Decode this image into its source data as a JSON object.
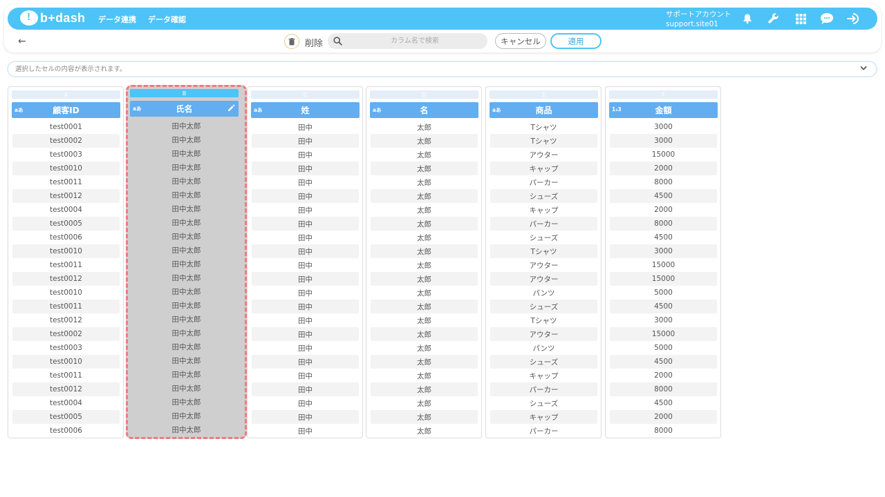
{
  "app": {
    "logo_text": "b+dash"
  },
  "nav": [
    "データ連携",
    "データ確認"
  ],
  "account": {
    "name": "サポートアカウント",
    "id": "support.site01"
  },
  "icons": {
    "top": [
      "bell-icon",
      "wrench-icon",
      "grid-icon",
      "chat-icon",
      "logout-icon"
    ],
    "toolbar": [
      "back-arrow-icon",
      "trash-icon",
      "search-icon"
    ]
  },
  "toolbar": {
    "back": "←",
    "delete_label": "削除",
    "search_placeholder": "カラム名で検索",
    "cancel_label": "キャンセル",
    "apply_label": "適用"
  },
  "cell_bar": {
    "placeholder": "選択したセルの内容が表示されます。"
  },
  "colors": {
    "brand": "#4ec3f7",
    "column_header": "#62aef0",
    "selection_border": "#f07a80"
  },
  "columns": [
    {
      "letter": "A",
      "type": "aあ",
      "name": "顧客ID",
      "selected": false,
      "values": [
        "test0001",
        "test0002",
        "test0003",
        "test0010",
        "test0011",
        "test0012",
        "test0004",
        "test0005",
        "test0006",
        "test0010",
        "test0011",
        "test0012",
        "test0010",
        "test0011",
        "test0012",
        "test0002",
        "test0003",
        "test0010",
        "test0011",
        "test0012",
        "test0004",
        "test0005",
        "test0006"
      ]
    },
    {
      "letter": "B",
      "type": "aあ",
      "name": "氏名",
      "selected": true,
      "values": [
        "田中太郎",
        "田中太郎",
        "田中太郎",
        "田中太郎",
        "田中太郎",
        "田中太郎",
        "田中太郎",
        "田中太郎",
        "田中太郎",
        "田中太郎",
        "田中太郎",
        "田中太郎",
        "田中太郎",
        "田中太郎",
        "田中太郎",
        "田中太郎",
        "田中太郎",
        "田中太郎",
        "田中太郎",
        "田中太郎",
        "田中太郎",
        "田中太郎",
        "田中太郎"
      ]
    },
    {
      "letter": "C",
      "type": "aあ",
      "name": "姓",
      "selected": false,
      "values": [
        "田中",
        "田中",
        "田中",
        "田中",
        "田中",
        "田中",
        "田中",
        "田中",
        "田中",
        "田中",
        "田中",
        "田中",
        "田中",
        "田中",
        "田中",
        "田中",
        "田中",
        "田中",
        "田中",
        "田中",
        "田中",
        "田中",
        "田中"
      ]
    },
    {
      "letter": "D",
      "type": "aあ",
      "name": "名",
      "selected": false,
      "values": [
        "太郎",
        "太郎",
        "太郎",
        "太郎",
        "太郎",
        "太郎",
        "太郎",
        "太郎",
        "太郎",
        "太郎",
        "太郎",
        "太郎",
        "太郎",
        "太郎",
        "太郎",
        "太郎",
        "太郎",
        "太郎",
        "太郎",
        "太郎",
        "太郎",
        "太郎",
        "太郎"
      ]
    },
    {
      "letter": "E",
      "type": "aあ",
      "name": "商品",
      "selected": false,
      "values": [
        "Tシャツ",
        "Tシャツ",
        "アウター",
        "キャップ",
        "パーカー",
        "シューズ",
        "キャップ",
        "パーカー",
        "シューズ",
        "Tシャツ",
        "アウター",
        "アウター",
        "パンツ",
        "シューズ",
        "Tシャツ",
        "アウター",
        "パンツ",
        "シューズ",
        "キャップ",
        "パーカー",
        "シューズ",
        "キャップ",
        "パーカー"
      ]
    },
    {
      "letter": "F",
      "type": "1₂3",
      "name": "金額",
      "selected": false,
      "values": [
        "3000",
        "3000",
        "15000",
        "2000",
        "8000",
        "4500",
        "2000",
        "8000",
        "4500",
        "3000",
        "15000",
        "15000",
        "5000",
        "4500",
        "3000",
        "15000",
        "5000",
        "4500",
        "2000",
        "8000",
        "4500",
        "2000",
        "8000"
      ]
    }
  ]
}
